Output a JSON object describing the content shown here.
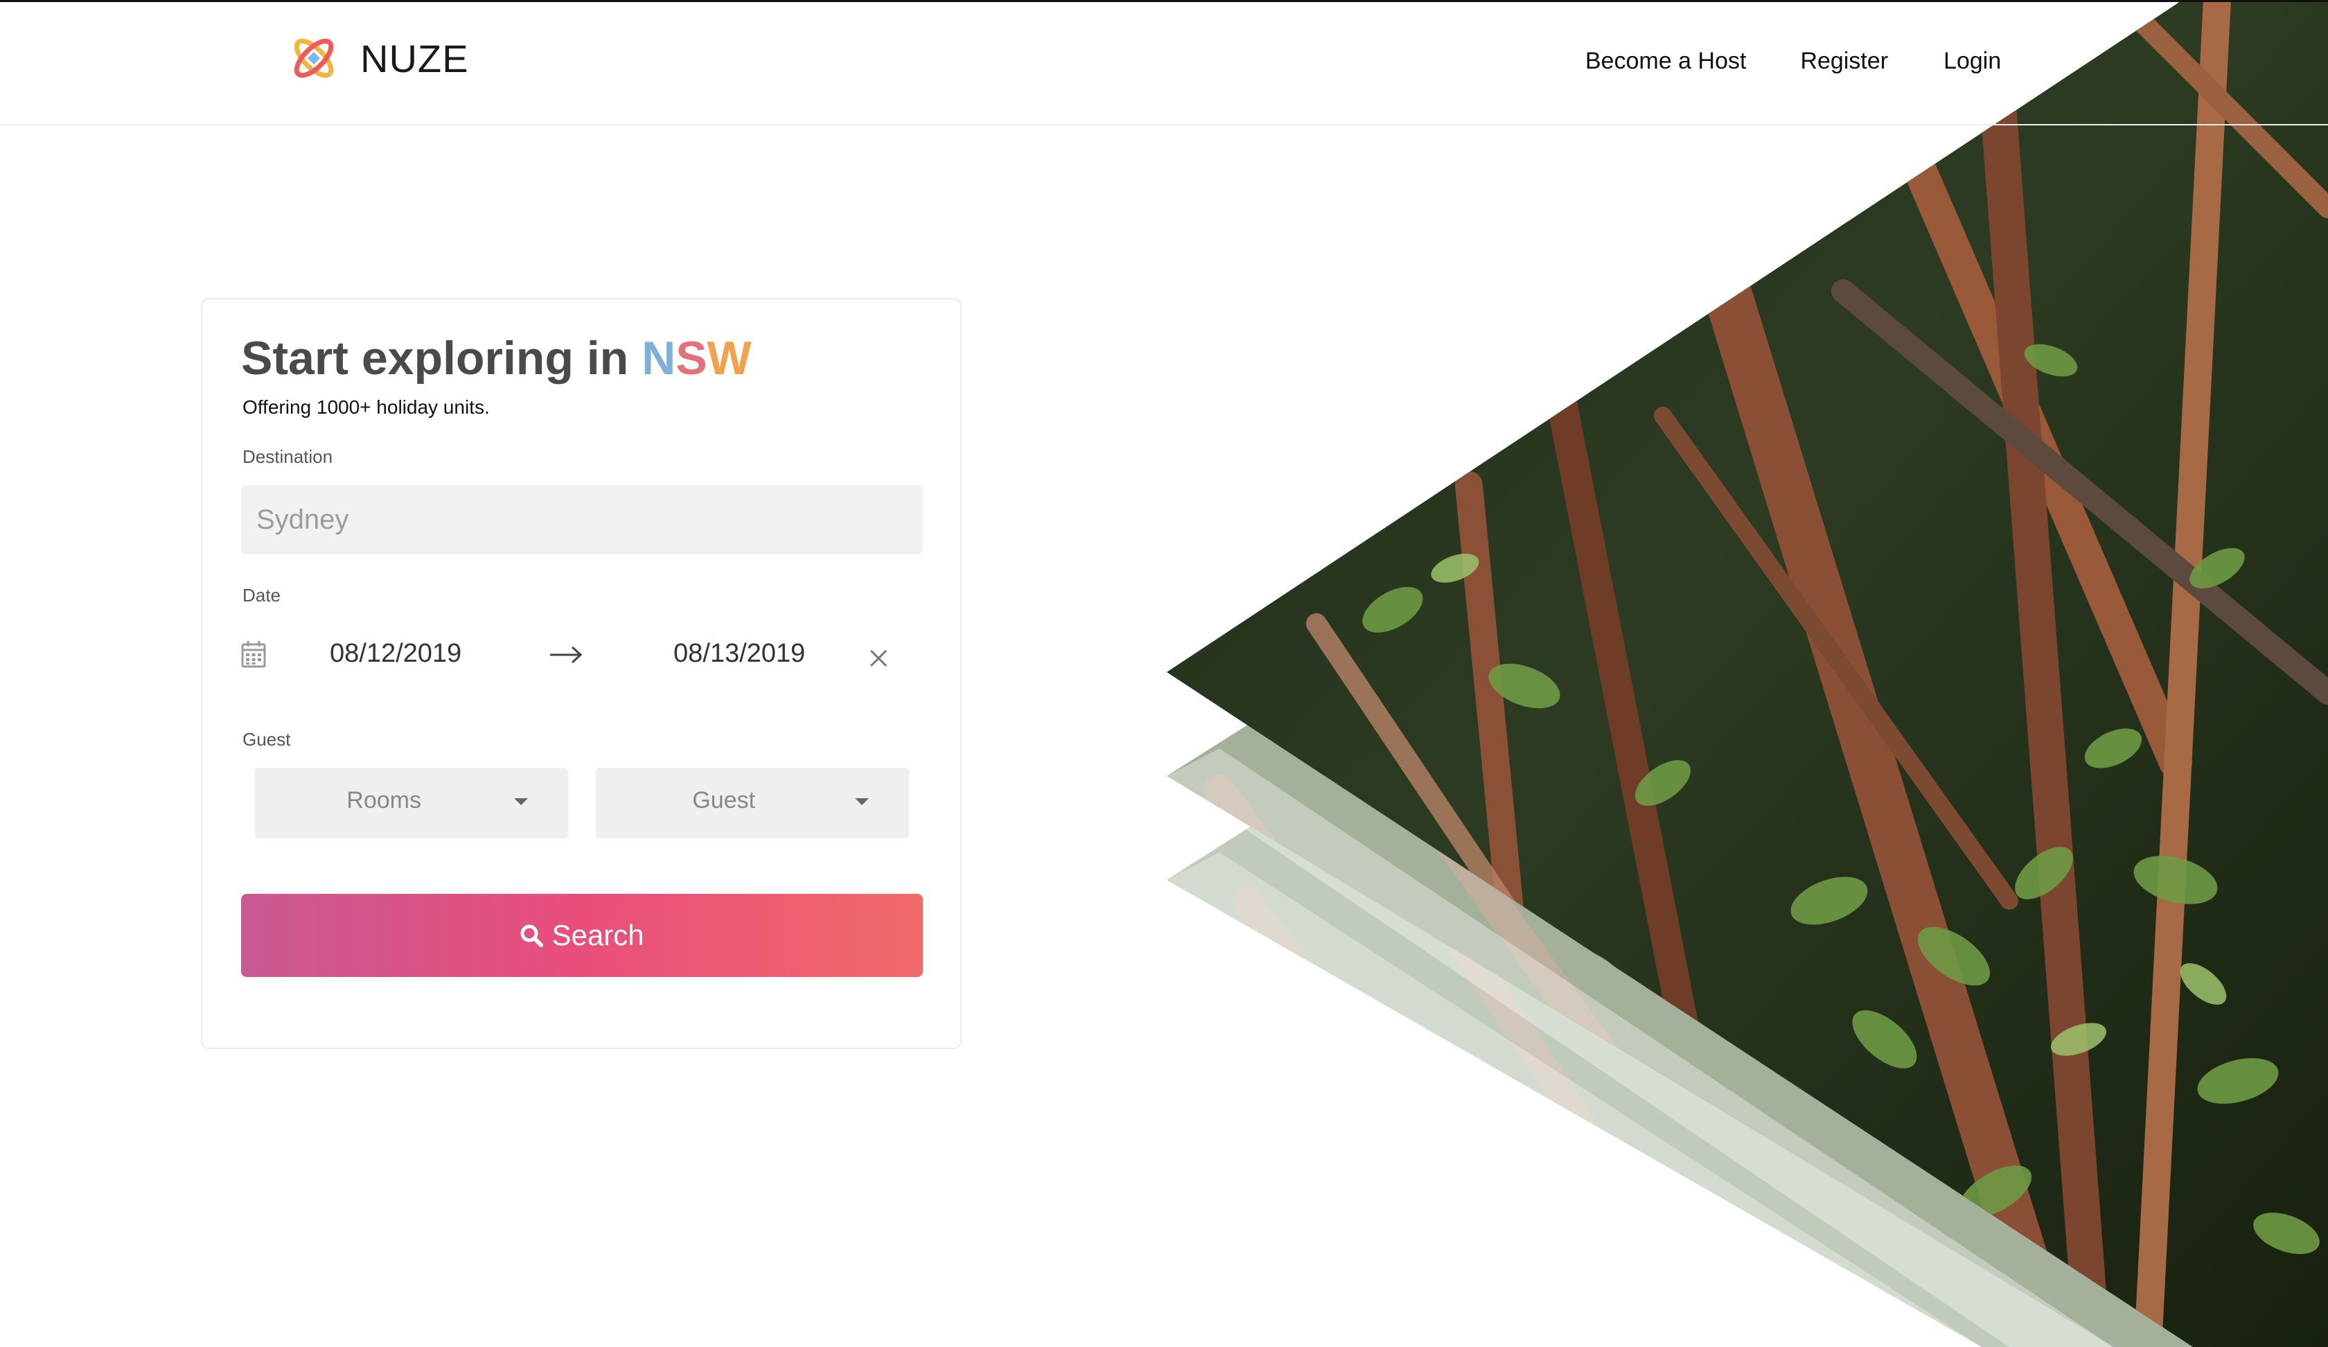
{
  "brand": {
    "name": "NUZE",
    "logo_icon": "atom-logo-icon",
    "logo_colors": [
      "#f2b63f",
      "#ef5a5a",
      "#7cb7e8"
    ]
  },
  "nav": {
    "become_host": "Become a Host",
    "register": "Register",
    "login": "Login"
  },
  "search_card": {
    "title_prefix": "Start exploring in ",
    "title_highlight": [
      "N",
      "S",
      "W"
    ],
    "highlight_colors": [
      "#7fb0d8",
      "#e4707a",
      "#f2a24a"
    ],
    "subtitle": "Offering 1000+ holiday units.",
    "destination": {
      "label": "Destination",
      "placeholder": "Sydney",
      "value": ""
    },
    "date": {
      "label": "Date",
      "start": "08/12/2019",
      "end": "08/13/2019",
      "icons": [
        "calendar-icon",
        "arrow-right-icon",
        "close-icon"
      ]
    },
    "guest": {
      "label": "Guest",
      "rooms_selected": "Rooms",
      "guest_selected": "Guest"
    },
    "search_button": {
      "label": "Search",
      "icon": "search-icon",
      "gradient": [
        "#c95a93",
        "#e94e7b",
        "#f06a6a"
      ]
    }
  },
  "hero": {
    "image": "forest-photo",
    "colors": [
      "#2b3a23",
      "#7a4a30",
      "#5e7c3a",
      "#a8a8a8"
    ]
  }
}
